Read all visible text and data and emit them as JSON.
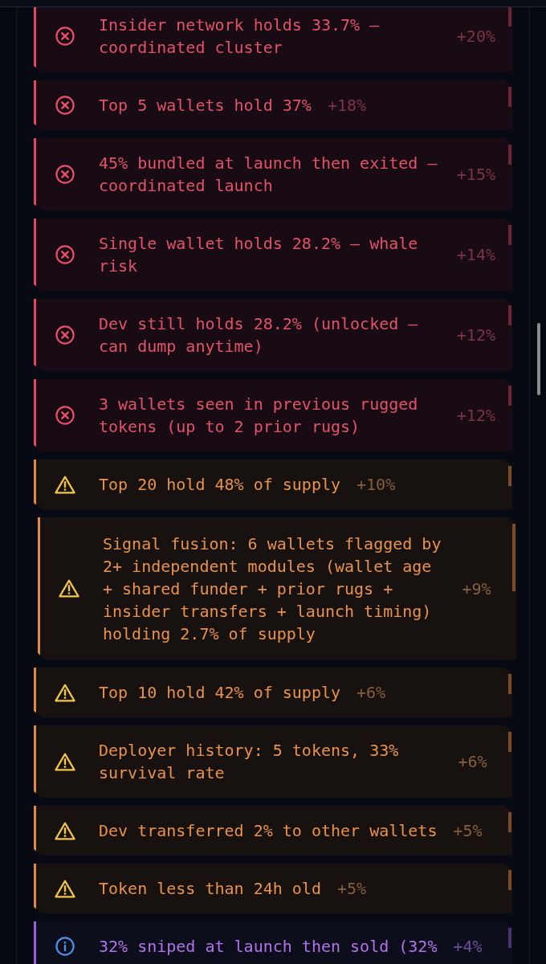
{
  "findings": [
    {
      "kind": "danger",
      "text": "Insider network holds 33.7% — coordinated cluster",
      "delta": "+20%",
      "hovered": false
    },
    {
      "kind": "danger",
      "text": "Top 5 wallets hold 37%",
      "delta": "+18%",
      "hovered": false
    },
    {
      "kind": "danger",
      "text": "45% bundled at launch then exited — coordinated launch",
      "delta": "+15%",
      "hovered": false
    },
    {
      "kind": "danger",
      "text": "Single wallet holds 28.2% — whale risk",
      "delta": "+14%",
      "hovered": false
    },
    {
      "kind": "danger",
      "text": "Dev still holds 28.2% (unlocked — can dump anytime)",
      "delta": "+12%",
      "hovered": false
    },
    {
      "kind": "danger",
      "text": "3 wallets seen in previous rugged tokens (up to 2 prior rugs)",
      "delta": "+12%",
      "hovered": false
    },
    {
      "kind": "warning",
      "text": "Top 20 hold 48% of supply",
      "delta": "+10%",
      "hovered": false
    },
    {
      "kind": "warning",
      "text": "Signal fusion: 6 wallets flagged by 2+ independent modules (wallet age + shared funder + prior rugs + insider transfers + launch timing) holding 2.7% of supply",
      "delta": "+9%",
      "hovered": true
    },
    {
      "kind": "warning",
      "text": "Top 10 hold 42% of supply",
      "delta": "+6%",
      "hovered": false
    },
    {
      "kind": "warning",
      "text": "Deployer history: 5 tokens, 33% survival rate",
      "delta": "+6%",
      "hovered": false
    },
    {
      "kind": "warning",
      "text": "Dev transferred 2% to other wallets",
      "delta": "+5%",
      "hovered": false
    },
    {
      "kind": "warning",
      "text": "Token less than 24h old",
      "delta": "+5%",
      "hovered": false
    },
    {
      "kind": "info",
      "text": "32% sniped at launch then sold (32%",
      "delta": "+4%",
      "hovered": false
    }
  ]
}
